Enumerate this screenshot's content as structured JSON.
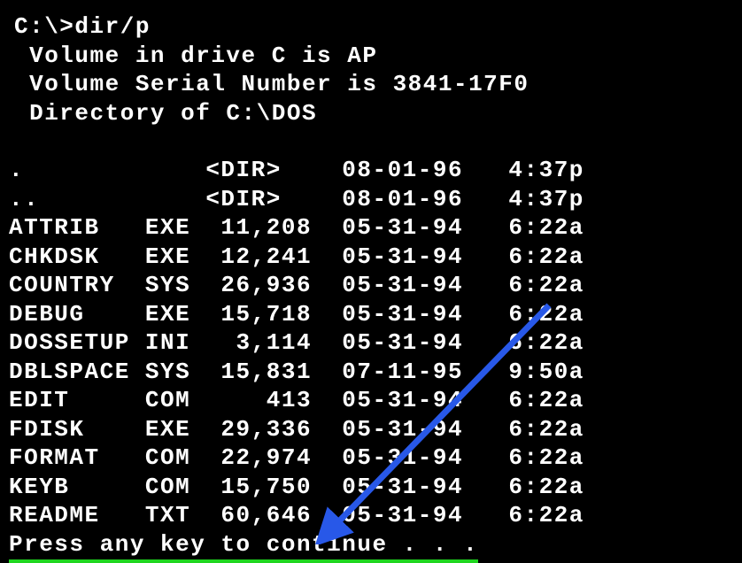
{
  "prompt": "C:\\>",
  "command": "dir/p",
  "volume_line": " Volume in drive C is AP",
  "serial_line": " Volume Serial Number is 3841-17F0",
  "directory_line": " Directory of C:\\DOS",
  "entries": [
    {
      "name": ".",
      "ext": "",
      "size": "<DIR>",
      "date": "08-01-96",
      "time": "4:37p"
    },
    {
      "name": "..",
      "ext": "",
      "size": "<DIR>",
      "date": "08-01-96",
      "time": "4:37p"
    },
    {
      "name": "ATTRIB",
      "ext": "EXE",
      "size": "11,208",
      "date": "05-31-94",
      "time": "6:22a"
    },
    {
      "name": "CHKDSK",
      "ext": "EXE",
      "size": "12,241",
      "date": "05-31-94",
      "time": "6:22a"
    },
    {
      "name": "COUNTRY",
      "ext": "SYS",
      "size": "26,936",
      "date": "05-31-94",
      "time": "6:22a"
    },
    {
      "name": "DEBUG",
      "ext": "EXE",
      "size": "15,718",
      "date": "05-31-94",
      "time": "6:22a"
    },
    {
      "name": "DOSSETUP",
      "ext": "INI",
      "size": "3,114",
      "date": "05-31-94",
      "time": "6:22a"
    },
    {
      "name": "DBLSPACE",
      "ext": "SYS",
      "size": "15,831",
      "date": "07-11-95",
      "time": "9:50a"
    },
    {
      "name": "EDIT",
      "ext": "COM",
      "size": "413",
      "date": "05-31-94",
      "time": "6:22a"
    },
    {
      "name": "FDISK",
      "ext": "EXE",
      "size": "29,336",
      "date": "05-31-94",
      "time": "6:22a"
    },
    {
      "name": "FORMAT",
      "ext": "COM",
      "size": "22,974",
      "date": "05-31-94",
      "time": "6:22a"
    },
    {
      "name": "KEYB",
      "ext": "COM",
      "size": "15,750",
      "date": "05-31-94",
      "time": "6:22a"
    },
    {
      "name": "README",
      "ext": "TXT",
      "size": "60,646",
      "date": "05-31-94",
      "time": "6:22a"
    }
  ],
  "continue_text": "Press any key to continue . . ."
}
